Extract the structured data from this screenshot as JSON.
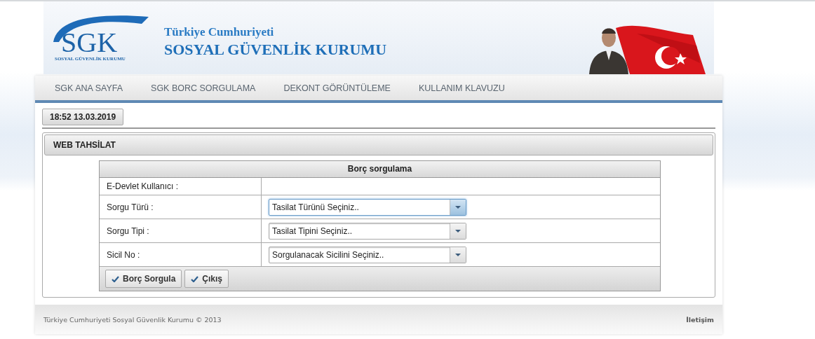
{
  "header": {
    "logo": {
      "mark": "SGK",
      "subtitle": "SOSYAL GÜVENLİK KURUMU"
    },
    "title_small": "Türkiye Cumhuriyeti",
    "title_large": "SOSYAL GÜVENLİK KURUMU"
  },
  "nav": [
    {
      "label": "SGK ANA SAYFA"
    },
    {
      "label": "SGK BORC SORGULAMA"
    },
    {
      "label": "DEKONT GÖRÜNTÜLEME"
    },
    {
      "label": "KULLANIM KLAVUZU"
    }
  ],
  "datetime": "18:52 13.03.2019",
  "panel": {
    "title": "WEB TAHSİLAT",
    "form": {
      "title": "Borç sorgulama",
      "rows": [
        {
          "kind": "text",
          "label": "E-Devlet Kullanıcı :"
        },
        {
          "kind": "select",
          "label": "Sorgu Türü :",
          "value": "Tasilat Türünü Seçiniz..",
          "focused": true
        },
        {
          "kind": "select",
          "label": "Sorgu Tipi :",
          "value": "Tasilat Tipini Seçiniz..",
          "focused": false
        },
        {
          "kind": "select",
          "label": "Sicil No :",
          "value": "Sorgulanacak Sicilini Seçiniz..",
          "focused": false
        }
      ],
      "buttons": [
        "Borç Sorgula",
        "Çıkış"
      ]
    }
  },
  "footer": {
    "copyright": "Türkiye Cumhuriyeti Sosyal Güvenlik Kurumu © 2013",
    "link": "İletişim"
  }
}
